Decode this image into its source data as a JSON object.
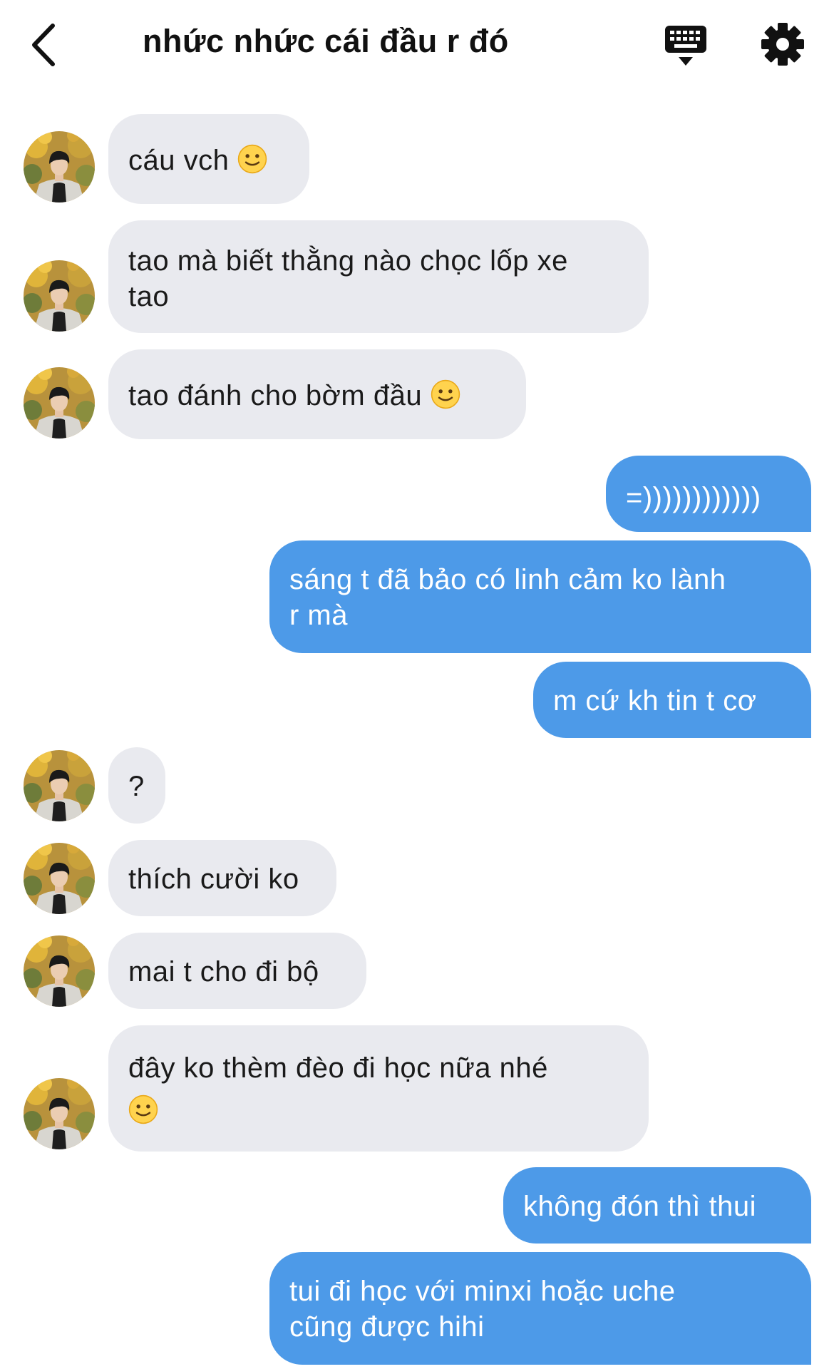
{
  "header": {
    "title": "nhức nhức cái đầu r đó",
    "back_icon": "chevron-left-icon",
    "keyboard_icon": "keyboard-icon",
    "settings_icon": "gear-icon"
  },
  "colors": {
    "incoming_bubble": "#E9EAEF",
    "outgoing_bubble": "#4D9AE8"
  },
  "messages": [
    {
      "from": "them",
      "text": "cáu vch",
      "emoji": "slightly-smiling-face"
    },
    {
      "from": "them",
      "line1": "tao mà biết thằng nào chọc lốp xe",
      "line2": "tao"
    },
    {
      "from": "them",
      "text": "tao đánh cho bờm đầu",
      "emoji": "slightly-smiling-face"
    },
    {
      "from": "me",
      "text": "=))))))))))))"
    },
    {
      "from": "me",
      "line1": "sáng t đã bảo có linh cảm ko lành",
      "line2": "r mà"
    },
    {
      "from": "me",
      "text": "m cứ kh tin t cơ"
    },
    {
      "from": "them",
      "text": "?"
    },
    {
      "from": "them",
      "text": "thích cười ko"
    },
    {
      "from": "them",
      "text": "mai t cho đi bộ"
    },
    {
      "from": "them",
      "line1": "đây ko thèm đèo đi học nữa nhé",
      "emoji": "slightly-smiling-face"
    },
    {
      "from": "me",
      "text": "không đón thì thui"
    },
    {
      "from": "me",
      "line1": "tui đi học với minxi hoặc uche",
      "line2": "cũng được hihi"
    }
  ]
}
